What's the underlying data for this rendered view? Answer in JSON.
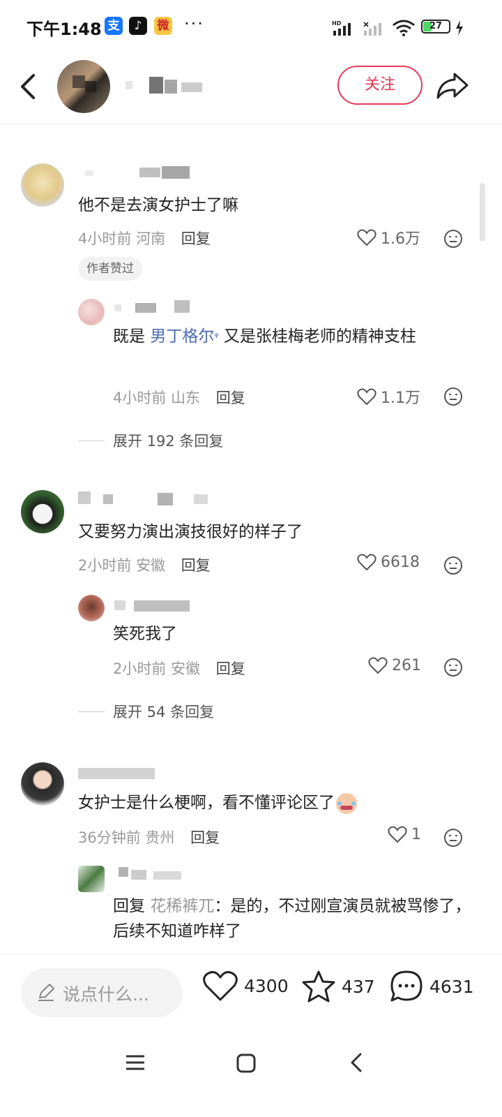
{
  "status_bar": {
    "time": "下午1:48",
    "apps": [
      "支",
      "♪",
      "微"
    ],
    "more": "···",
    "battery": "27"
  },
  "header": {
    "follow_label": "关注"
  },
  "comments": [
    {
      "text": "他不是去演女护士了嘛",
      "time": "4小时前",
      "location": "河南",
      "reply_label": "回复",
      "likes": "1.6万",
      "author_badge": "作者赞过",
      "replies": [
        {
          "text_before": "既是 ",
          "link": "男丁格尔",
          "text_after": " 又是张桂梅老师的精神支柱",
          "time": "4小时前",
          "location": "山东",
          "reply_label": "回复",
          "likes": "1.1万"
        }
      ],
      "expand_label": "展开 192 条回复"
    },
    {
      "text": "又要努力演出演技很好的样子了",
      "time": "2小时前",
      "location": "安徽",
      "reply_label": "回复",
      "likes": "6618",
      "replies": [
        {
          "text": "笑死我了",
          "time": "2小时前",
          "location": "安徽",
          "reply_label": "回复",
          "likes": "261"
        }
      ],
      "expand_label": "展开 54 条回复"
    },
    {
      "text": "女护士是什么梗啊，看不懂评论区了",
      "time": "36分钟前",
      "location": "贵州",
      "reply_label": "回复",
      "likes": "1",
      "replies": [
        {
          "prefix": "回复",
          "reply_to": "花稀裤兀",
          "text": "：是的，不过刚宣演员就被骂惨了，后续不知道咋样了"
        }
      ]
    }
  ],
  "bottom_bar": {
    "input_placeholder": "说点什么...",
    "likes": "4300",
    "stars": "437",
    "comments": "4631"
  }
}
